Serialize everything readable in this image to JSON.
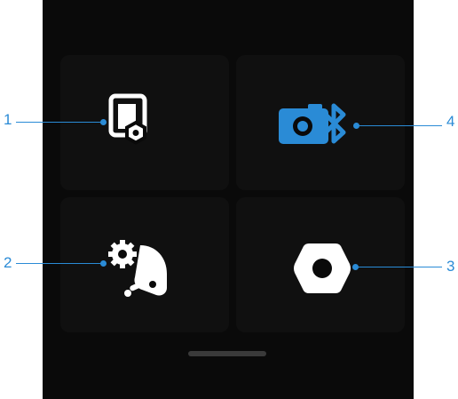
{
  "colors": {
    "screen_background": "#0a0a0a",
    "tile_background": "#101010",
    "icon_white": "#ffffff",
    "camera_bluetooth_blue": "#2a8bd6",
    "callout_blue": "#2a8bd6",
    "home_indicator": "#3a3a3a"
  },
  "menu": {
    "tiles": [
      {
        "icon": "screen-settings-icon",
        "callout": "1",
        "highlighted": false
      },
      {
        "icon": "camera-bluetooth-icon",
        "callout": "4",
        "highlighted": true
      },
      {
        "icon": "gimbal-settings-icon",
        "callout": "2",
        "highlighted": false
      },
      {
        "icon": "settings-nut-icon",
        "callout": "3",
        "highlighted": false
      }
    ]
  },
  "callouts": {
    "one": "1",
    "two": "2",
    "three": "3",
    "four": "4"
  }
}
